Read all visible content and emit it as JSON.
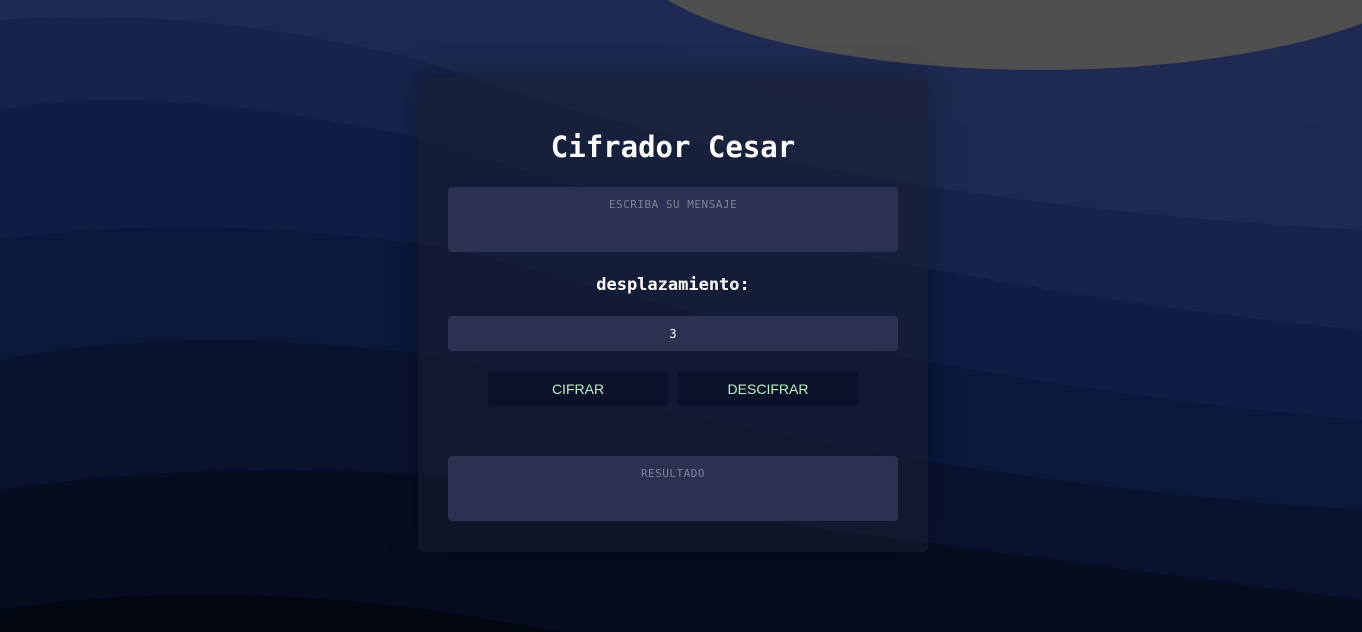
{
  "colors": {
    "page_background": "#0a1634",
    "card_background": "#1a1d2e",
    "field_background": "#2c3152",
    "button_background": "#0a1128",
    "button_text": "#b9f1c4",
    "title_text": "#ffffff",
    "placeholder_text": "#7f8296"
  },
  "app": {
    "title": "Cifrador Cesar"
  },
  "message": {
    "placeholder": "ESCRIBA SU MENSAJE",
    "value": ""
  },
  "shift": {
    "label": "desplazamiento:",
    "value": "3"
  },
  "actions": {
    "cipher_label": "CIFRAR",
    "decipher_label": "DESCIFRAR"
  },
  "result": {
    "placeholder": "RESULTADO",
    "value": ""
  }
}
